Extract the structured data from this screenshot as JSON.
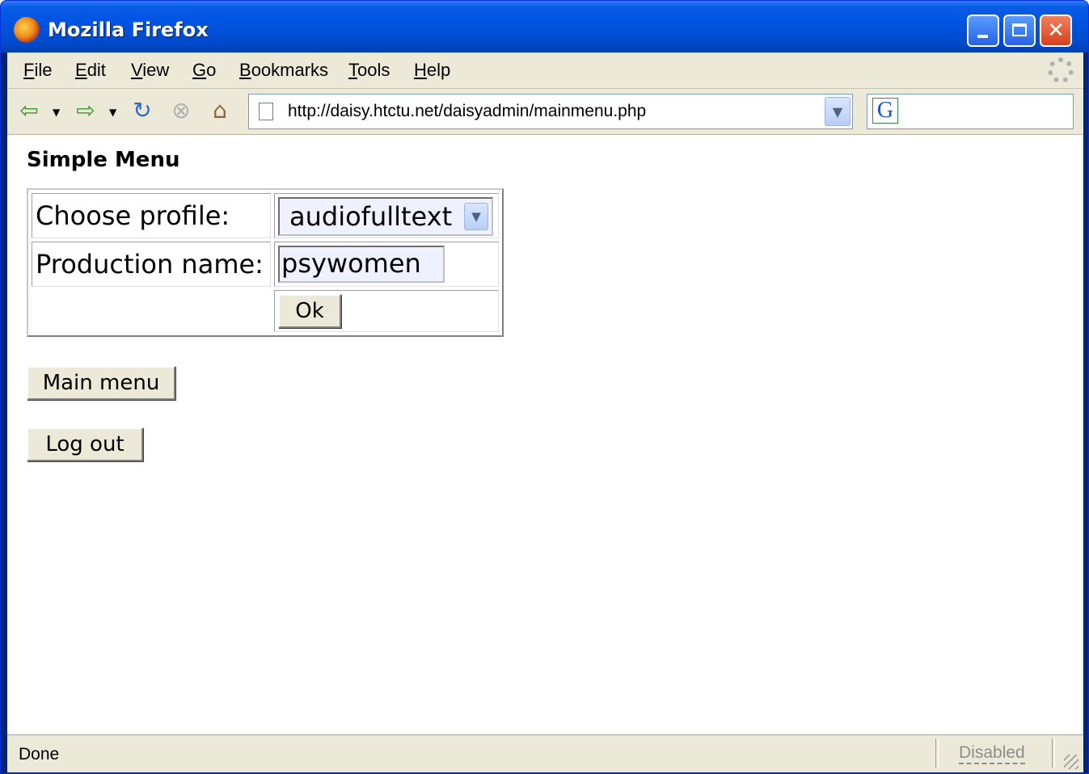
{
  "window": {
    "title": "Mozilla Firefox"
  },
  "menubar": {
    "items": [
      {
        "label": "File",
        "accel": "F",
        "rest": "ile"
      },
      {
        "label": "Edit",
        "accel": "E",
        "rest": "dit"
      },
      {
        "label": "View",
        "accel": "V",
        "rest": "iew"
      },
      {
        "label": "Go",
        "accel": "G",
        "rest": "o"
      },
      {
        "label": "Bookmarks",
        "accel": "B",
        "rest": "ookmarks"
      },
      {
        "label": "Tools",
        "accel": "T",
        "rest": "ools"
      },
      {
        "label": "Help",
        "accel": "H",
        "rest": "elp"
      }
    ]
  },
  "toolbar": {
    "url": "http://daisy.htctu.net/daisyadmin/mainmenu.php",
    "search_value": ""
  },
  "page": {
    "title": "Simple Menu",
    "profile_label": "Choose profile:",
    "profile_value": "audiofulltext",
    "production_label": "Production name:",
    "production_value": "psywomen",
    "ok_label": "Ok",
    "main_menu_label": "Main menu",
    "logout_label": "Log out"
  },
  "statusbar": {
    "status": "Done",
    "popup_state": "Disabled"
  },
  "colors": {
    "titlebar": "#0054e3",
    "chrome": "#ece9d8",
    "input_bg": "#eef2ff"
  }
}
